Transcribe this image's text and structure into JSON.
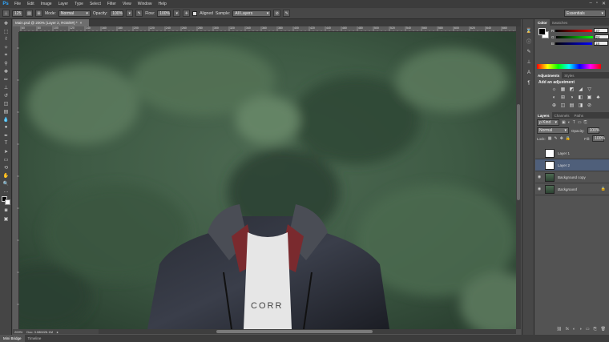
{
  "app": {
    "logo": "Ps"
  },
  "menu": [
    "File",
    "Edit",
    "Image",
    "Layer",
    "Type",
    "Select",
    "Filter",
    "View",
    "Window",
    "Help"
  ],
  "window_controls": [
    "–",
    "▫",
    "✕"
  ],
  "options": {
    "mode_label": "Mode:",
    "mode_value": "Normal",
    "opacity_label": "Opacity:",
    "opacity_value": "100%",
    "flow_label": "Flow:",
    "flow_value": "100%",
    "aligned_label": "Aligned",
    "sample_label": "Sample:",
    "sample_value": "All Layers",
    "brush_size": "125"
  },
  "workspace": "Essentials",
  "document": {
    "tab_title": "Main.psd @ 200% (Layer 2, RGB/8#) *",
    "close": "×"
  },
  "ruler_labels": [
    "60",
    "80",
    "100",
    "120",
    "140",
    "160",
    "180",
    "200",
    "220",
    "240",
    "260",
    "280",
    "300",
    "320",
    "340",
    "360",
    "380",
    "400",
    "420",
    "440",
    "460",
    "480",
    "500",
    "520",
    "540",
    "560",
    "580",
    "600",
    "620",
    "640",
    "660"
  ],
  "status": {
    "zoom": "200%",
    "doc": "Doc: 3.08M/26.1M"
  },
  "bottom_tabs": [
    "Mini Bridge",
    "Timeline"
  ],
  "color_panel": {
    "tabs": [
      "Color",
      "Swatches"
    ],
    "channels": [
      {
        "label": "R",
        "value": "27"
      },
      {
        "label": "G",
        "value": "24"
      },
      {
        "label": "B",
        "value": "18"
      }
    ]
  },
  "adjustments_panel": {
    "tabs": [
      "Adjustments",
      "Styles"
    ],
    "heading": "Add an adjustment",
    "icons": [
      "☼",
      "▦",
      "◩",
      "◢",
      "▽",
      "◐",
      "⊞",
      "◑",
      "◧",
      "▣",
      "♣",
      "⊕",
      "◫",
      "▤",
      "◨",
      "⊘",
      "◪",
      "▩",
      "✎",
      "◦"
    ]
  },
  "layers_panel": {
    "tabs": [
      "Layers",
      "Channels",
      "Paths"
    ],
    "kind": "ρ Kind",
    "blend": "Normal",
    "opacity_label": "Opacity:",
    "opacity_value": "100%",
    "lock_label": "Lock:",
    "fill_label": "Fill:",
    "fill_value": "100%",
    "layers": [
      {
        "name": "Layer 1",
        "visible": false,
        "selected": false,
        "thumb": "white",
        "locked": false
      },
      {
        "name": "Layer 2",
        "visible": false,
        "selected": true,
        "thumb": "white",
        "locked": false
      },
      {
        "name": "Background copy",
        "visible": true,
        "selected": false,
        "thumb": "photo",
        "locked": false
      },
      {
        "name": "Background",
        "visible": true,
        "selected": false,
        "thumb": "photo",
        "locked": true
      }
    ],
    "footer_icons": [
      "⛓",
      "fx",
      "◐",
      "◑",
      "▭",
      "⎘",
      "🗑"
    ]
  },
  "canvas_text": {
    "shirt": "CORR"
  },
  "colors": {
    "accent": "#31a8ff",
    "selected_layer": "#4f5f7a",
    "foreground": "#000000",
    "background": "#ffffff"
  }
}
